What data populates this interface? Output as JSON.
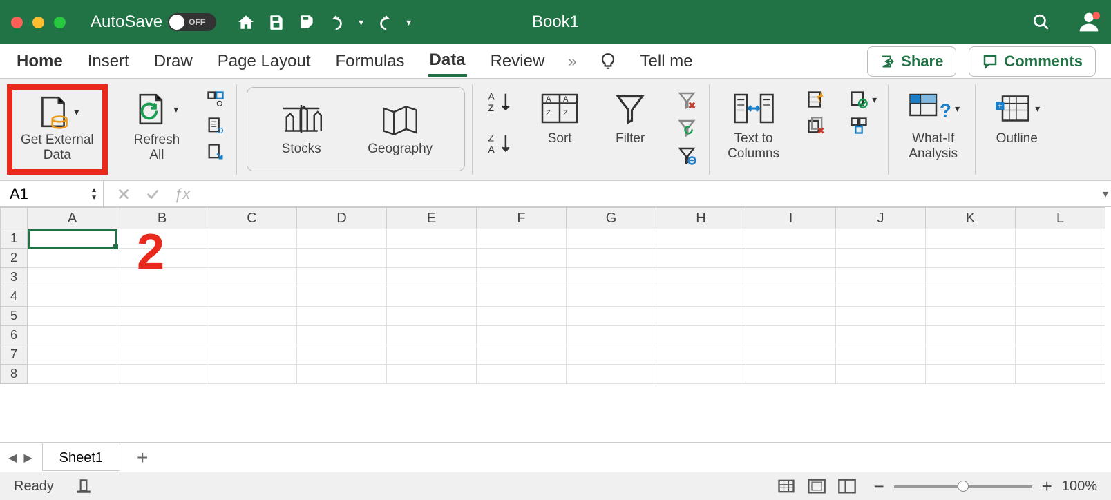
{
  "titlebar": {
    "autosave_label": "AutoSave",
    "autosave_state": "OFF",
    "document_title": "Book1"
  },
  "tabs": {
    "items": [
      "Home",
      "Insert",
      "Draw",
      "Page Layout",
      "Formulas",
      "Data",
      "Review"
    ],
    "active_index": 5,
    "tell_me": "Tell me",
    "share": "Share",
    "comments": "Comments"
  },
  "ribbon": {
    "get_external_data": "Get External\nData",
    "refresh": "Refresh\nAll",
    "stocks": "Stocks",
    "geography": "Geography",
    "sort": "Sort",
    "filter": "Filter",
    "text_to_columns": "Text to\nColumns",
    "whatif": "What-If\nAnalysis",
    "outline": "Outline"
  },
  "annotation": {
    "step": "2"
  },
  "formula_bar": {
    "name_box": "A1"
  },
  "grid": {
    "columns": [
      "A",
      "B",
      "C",
      "D",
      "E",
      "F",
      "G",
      "H",
      "I",
      "J",
      "K",
      "L"
    ],
    "row_count": 8
  },
  "sheets": {
    "items": [
      "Sheet1"
    ]
  },
  "statusbar": {
    "status": "Ready",
    "zoom": "100%"
  }
}
